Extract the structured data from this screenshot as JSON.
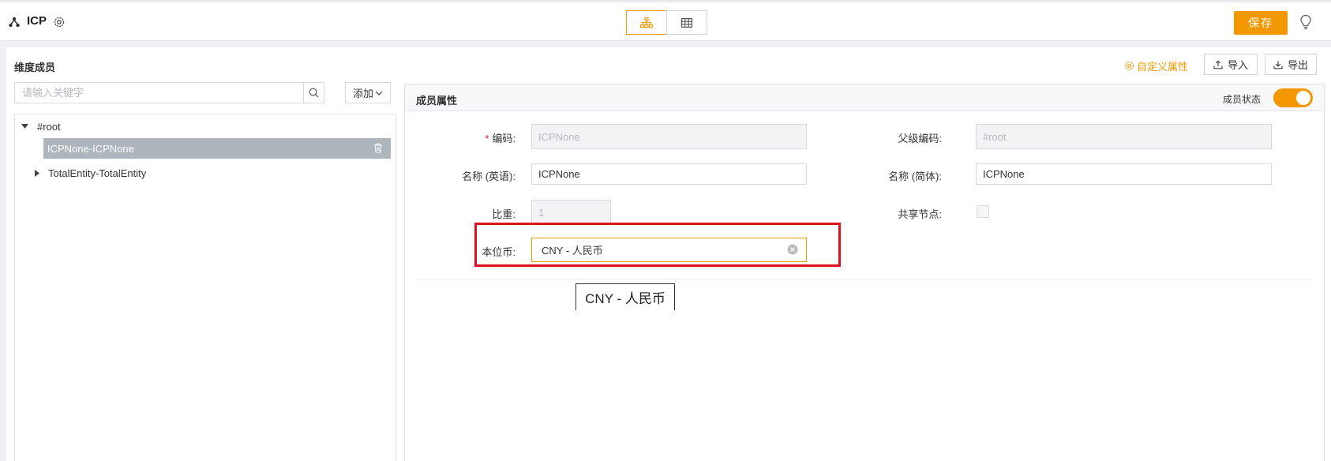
{
  "header": {
    "title": "ICP",
    "save_label": "保存"
  },
  "left": {
    "section_title": "维度成员",
    "search_placeholder": "请输入关键字",
    "add_label": "添加",
    "tree": {
      "root": "#root",
      "selected": "ICPNone-ICPNone",
      "child2": "TotalEntity-TotalEntity"
    }
  },
  "toolbar": {
    "custom_attr": "自定义属性",
    "import": "导入",
    "export": "导出"
  },
  "props": {
    "title": "成员属性",
    "status_label": "成员状态",
    "status_on": true,
    "fields": {
      "code_label": "编码:",
      "code_value": "ICPNone",
      "parent_code_label": "父级编码:",
      "parent_code_value": "#root",
      "name_en_label": "名称 (英语):",
      "name_en_value": "ICPNone",
      "name_cn_label": "名称 (简体):",
      "name_cn_value": "ICPNone",
      "weight_label": "比重:",
      "weight_value": "1",
      "shared_label": "共享节点:",
      "currency_label": "本位币:",
      "currency_value": "CNY - 人民币"
    },
    "tooltip": "CNY - 人民币"
  },
  "colors": {
    "accent": "#f39800",
    "highlight": "#e0101e",
    "selected_row": "#adb5bd"
  }
}
